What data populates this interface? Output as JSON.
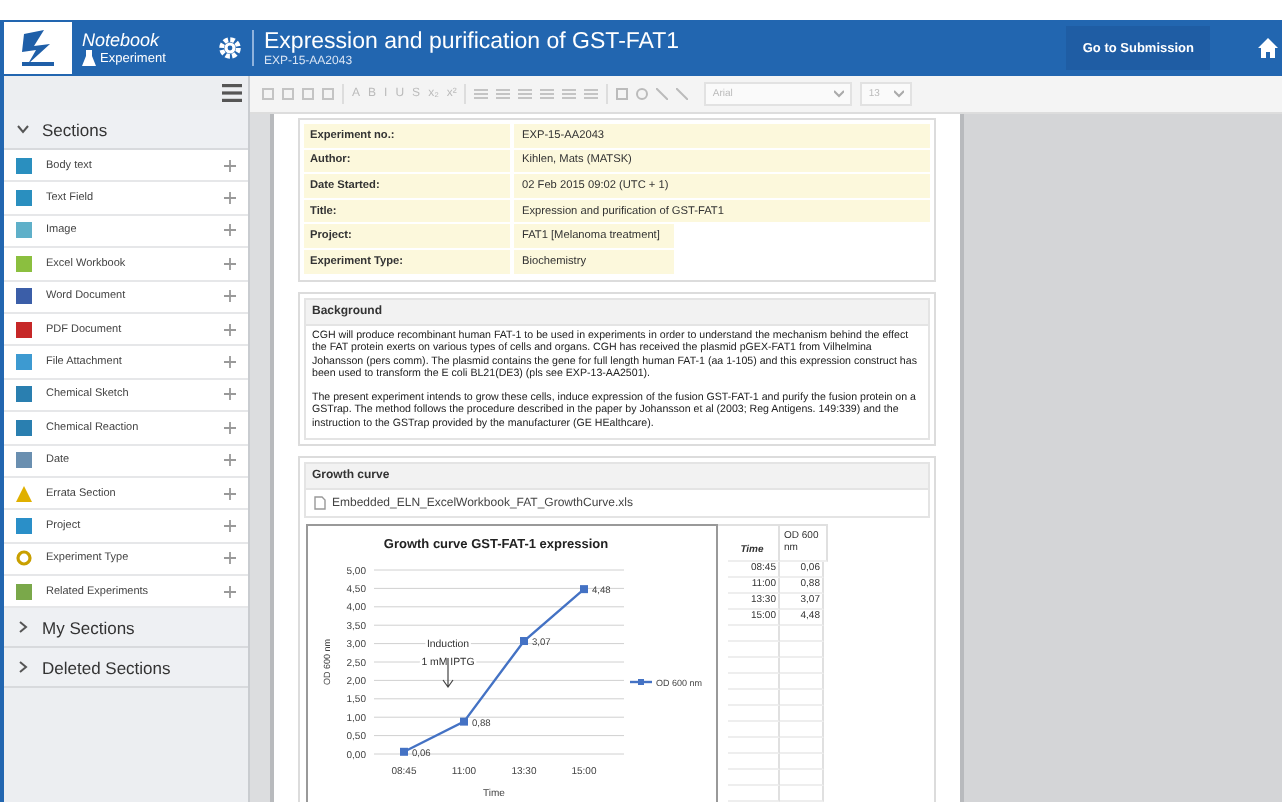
{
  "header": {
    "app": "Notebook",
    "mode": "Experiment",
    "title": "Expression and purification of GST-FAT1",
    "subtitle": "EXP-15-AA2043",
    "submit": "Go to Submission"
  },
  "sidebar": {
    "groups": [
      {
        "label": "Sections",
        "expanded": true,
        "items": [
          {
            "label": "Body text",
            "kind": "text"
          },
          {
            "label": "Text Field",
            "kind": "text"
          },
          {
            "label": "Image",
            "kind": "image"
          },
          {
            "label": "Excel Workbook",
            "kind": "excel"
          },
          {
            "label": "Word Document",
            "kind": "word"
          },
          {
            "label": "PDF Document",
            "kind": "pdf"
          },
          {
            "label": "File Attachment",
            "kind": "file"
          },
          {
            "label": "Chemical Sketch",
            "kind": "chem"
          },
          {
            "label": "Chemical Reaction",
            "kind": "chem"
          },
          {
            "label": "Date",
            "kind": "date"
          },
          {
            "label": "Errata Section",
            "kind": "warning"
          },
          {
            "label": "Project",
            "kind": "folder"
          },
          {
            "label": "Experiment Type",
            "kind": "tag"
          },
          {
            "label": "Related Experiments",
            "kind": "related"
          }
        ]
      },
      {
        "label": "My Sections",
        "expanded": false
      },
      {
        "label": "Deleted Sections",
        "expanded": false
      }
    ]
  },
  "toolbar": {
    "format_buttons": [
      "A",
      "B",
      "I",
      "U",
      "S",
      "x₂",
      "x²"
    ],
    "font": "Arial",
    "size": "13"
  },
  "meta": [
    {
      "label": "Experiment no.:",
      "value": "EXP-15-AA2043",
      "kind": "text"
    },
    {
      "label": "Author:",
      "value": "Kihlen, Mats (MATSK)",
      "kind": "text"
    },
    {
      "label": "Date Started:",
      "value": "02 Feb 2015 09:02 (UTC + 1)",
      "kind": "text"
    },
    {
      "label": "Title:",
      "value": "Expression and purification of GST-FAT1",
      "kind": "text"
    },
    {
      "label": "Project:",
      "value": "FAT1 [Melanoma treatment]",
      "kind": "chip"
    },
    {
      "label": "Experiment Type:",
      "value": "Biochemistry",
      "kind": "chip"
    }
  ],
  "background": {
    "title": "Background",
    "paragraphs": [
      "CGH will produce recombinant human FAT-1 to be used in experiments in order to understand the mechanism behind the effect the FAT protein exerts on various types of cells and organs. CGH has received the plasmid pGEX-FAT1 from Vilhelmina Johansson (pers comm). The plasmid contains the gene for full length human FAT-1 (aa 1-105) and this expression construct has been used to transform the E coli BL21(DE3) (pls see EXP-13-AA2501).",
      "The present experiment intends to grow these cells, induce expression of the fusion GST-FAT-1 and purify the fusion protein on a GSTrap. The method follows the procedure described in the paper by Johansson et al (2003; Reg Antigens. 149:339) and the instruction to the GSTrap provided by the manufacturer (GE HEalthcare)."
    ]
  },
  "growth": {
    "title": "Growth curve",
    "file": "Embedded_ELN_ExcelWorkbook_FAT_GrowthCurve.xls",
    "chart_data": {
      "type": "line",
      "title": "Growth curve GST-FAT-1 expression",
      "xlabel": "Time",
      "ylabel": "OD 600 nm",
      "categories": [
        "08:45",
        "11:00",
        "13:30",
        "15:00"
      ],
      "series": [
        {
          "name": "OD 600 nm",
          "color": "#4472c4",
          "marker": "square",
          "values": [
            0.06,
            0.88,
            3.07,
            4.48
          ]
        }
      ],
      "ylim": [
        0,
        5
      ],
      "yticks": [
        {
          "value": 0,
          "label": "0,00"
        },
        {
          "value": 0.5,
          "label": "0,50"
        },
        {
          "value": 1,
          "label": "1,00"
        },
        {
          "value": 1.5,
          "label": "1,50"
        },
        {
          "value": 2,
          "label": "2,00"
        },
        {
          "value": 2.5,
          "label": "2,50"
        },
        {
          "value": 3,
          "label": "3,00"
        },
        {
          "value": 3.5,
          "label": "3,50"
        },
        {
          "value": 4,
          "label": "4,00"
        },
        {
          "value": 4.5,
          "label": "4,50"
        },
        {
          "value": 5,
          "label": "5,00"
        }
      ],
      "value_labels": [
        "0,06",
        "0,88",
        "3,07",
        "4,48"
      ],
      "grid": true,
      "annotations": [
        "Induction",
        "1 mM IPTG"
      ]
    },
    "table": {
      "columns": [
        "Time",
        "OD 600 nm"
      ],
      "rows": [
        [
          "08:45",
          "0,06"
        ],
        [
          "11:00",
          "0,88"
        ],
        [
          "13:30",
          "3,07"
        ],
        [
          "15:00",
          "4,48"
        ]
      ]
    }
  }
}
